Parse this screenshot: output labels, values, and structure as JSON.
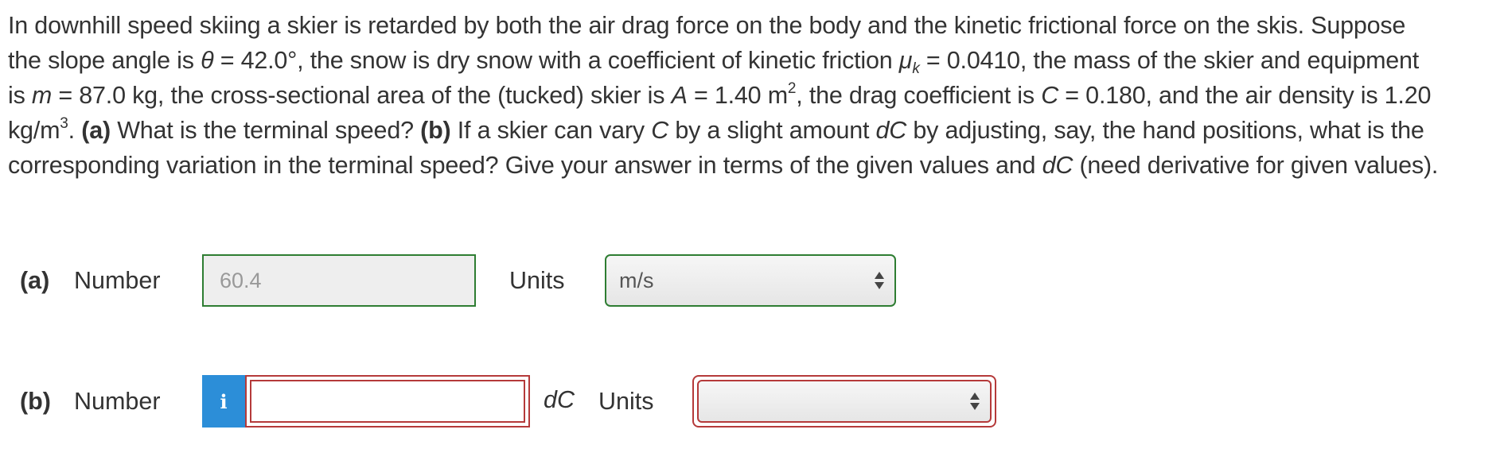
{
  "problem": {
    "line1": "In downhill speed skiing a skier is retarded by both the air drag force on the body and the kinetic frictional force on the skis. Suppose",
    "line2_a": "the slope angle is ",
    "theta_symbol": "θ",
    "line2_b": " = 42.0°, the snow is dry snow with a coefficient of kinetic friction ",
    "mu_symbol": "μ",
    "mu_sub": "k",
    "line2_c": " = 0.0410, the mass of the skier and equipment",
    "line3_a": "is ",
    "m_symbol": "m",
    "line3_b": " = 87.0 kg, the cross-sectional area of the (tucked) skier is ",
    "a_symbol": "A",
    "line3_c": " = 1.40 m",
    "area_exp": "2",
    "line3_d": ", the drag coefficient is ",
    "c_symbol": "C",
    "line3_e": " = 0.180, and the air density is 1.20",
    "line4_a": "kg/m",
    "density_exp": "3",
    "line4_b": ". ",
    "part_a_tag": "(a)",
    "line4_c": " What is the terminal speed? ",
    "part_b_tag": "(b)",
    "line4_d": " If a skier can vary ",
    "c_symbol_2": "C",
    "line4_e": " by a slight amount ",
    "dc_symbol": "dC",
    "line4_f": " by adjusting, say, the hand positions, what is the",
    "line5_a": "corresponding variation in the terminal speed? Give your answer in terms of the given values and ",
    "dc_symbol_2": "dC",
    "line5_b": " (need derivative for given values)."
  },
  "part_a": {
    "label": "(a)",
    "number_label": "Number",
    "number_value": "60.4",
    "units_label": "Units",
    "units_value": "m/s",
    "status_color": "#2e7d32"
  },
  "part_b": {
    "label": "(b)",
    "number_label": "Number",
    "info_icon": "i",
    "number_value": "",
    "dc_label": "dC",
    "units_label": "Units",
    "units_value": "",
    "status_color": "#b53a3a",
    "info_color": "#2c8ed8"
  }
}
